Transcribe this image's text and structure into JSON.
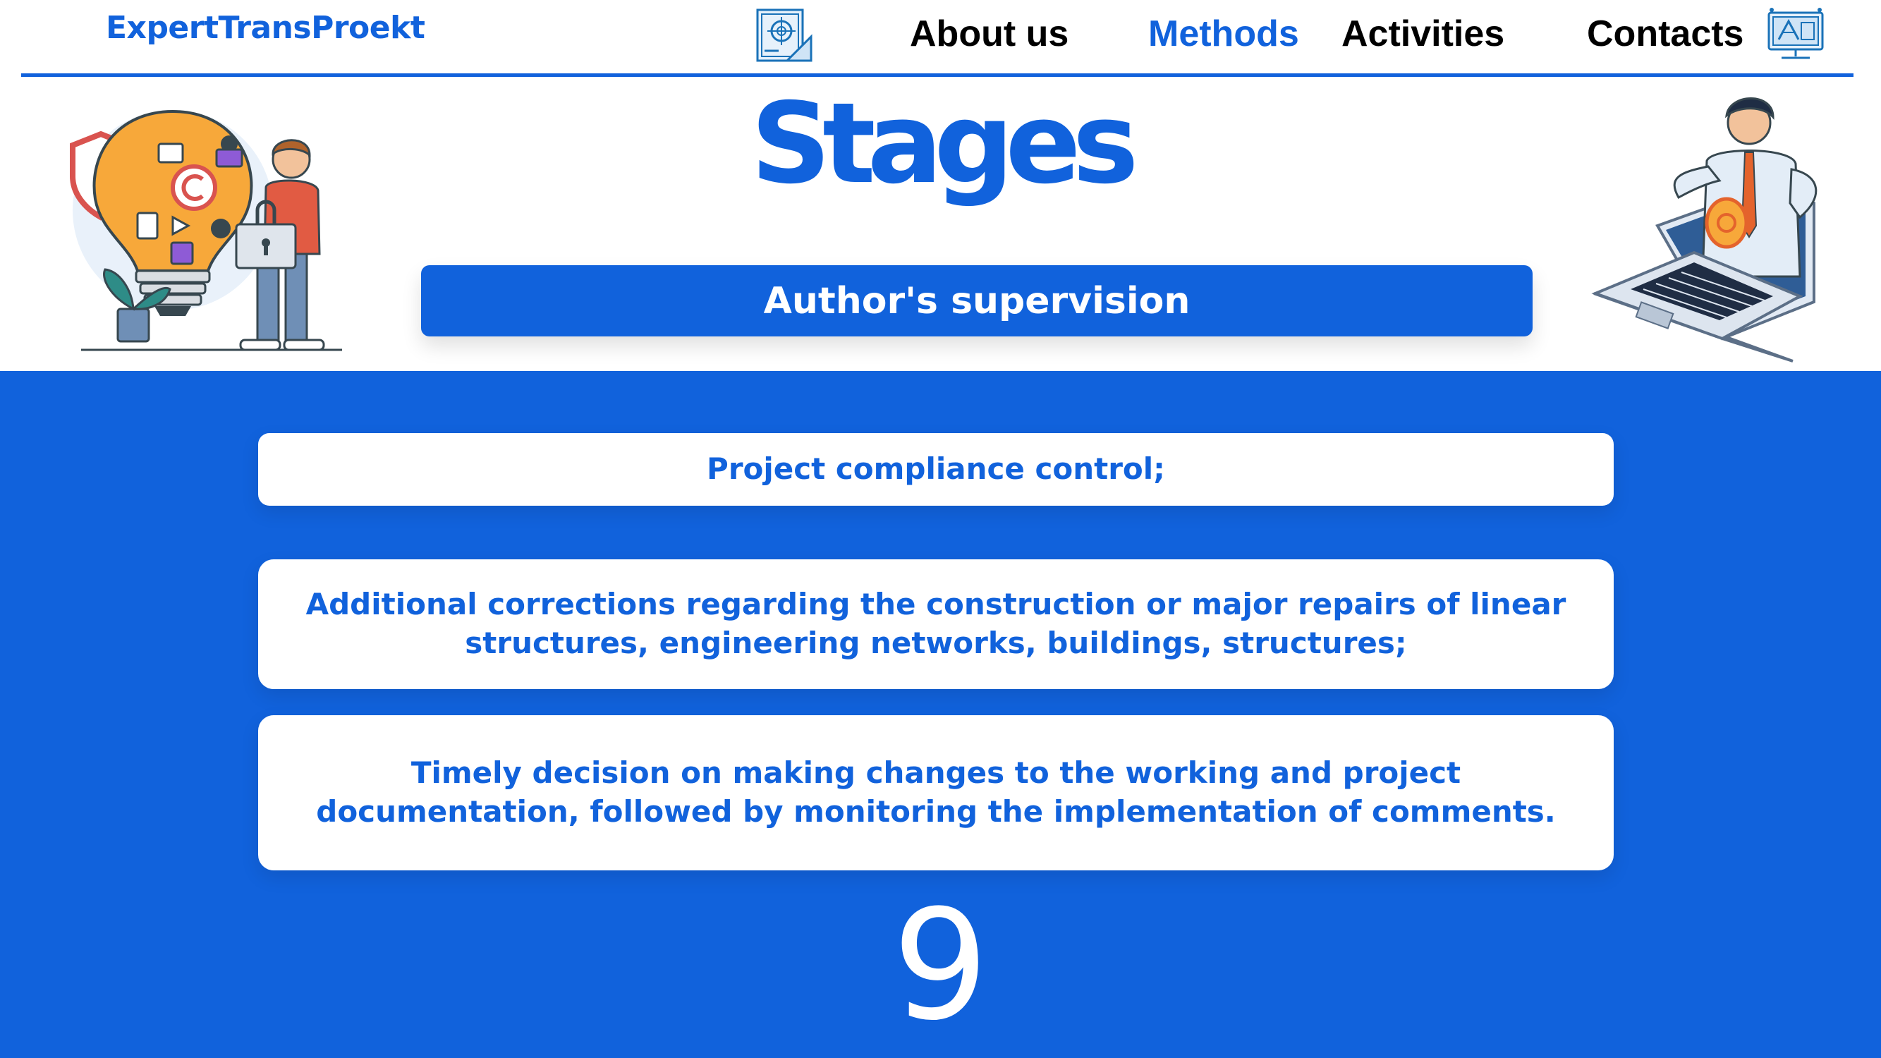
{
  "header": {
    "brand": "ExpertTransProekt",
    "nav": {
      "about": "About us",
      "methods": "Methods",
      "activities": "Activities",
      "contacts": "Contacts"
    },
    "icons": [
      "blueprint-icon",
      "drafting-monitor-icon"
    ],
    "accent_color": "#1162dc"
  },
  "hero": {
    "title": "Stages",
    "subtitle": "Author's supervision",
    "illustrations": [
      "lightbulb-copyright-illustration",
      "laptop-businessman-illustration"
    ]
  },
  "stages": [
    "Project compliance control;",
    "Additional corrections regarding the construction or major repairs of linear structures, engineering networks, buildings, structures;",
    "Timely decision on making changes to the working and project documentation, followed by monitoring the implementation of comments."
  ],
  "page_number": "9"
}
